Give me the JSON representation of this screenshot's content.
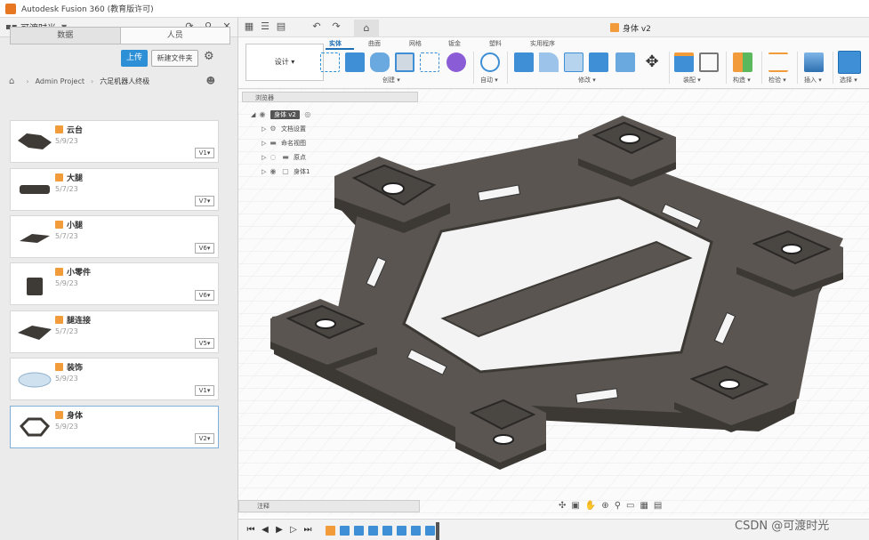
{
  "window": {
    "title": "Autodesk Fusion 360 (教育版许可)"
  },
  "data_panel": {
    "team_name": "可渡时光",
    "tabs": [
      "数据",
      "人员"
    ],
    "upload_label": "上传",
    "new_folder_label": "新建文件夹",
    "breadcrumb": [
      "Admin Project",
      "六足机器人终极"
    ],
    "files": [
      {
        "name": "云台",
        "date": "5/9/23",
        "version": "V1"
      },
      {
        "name": "大腿",
        "date": "5/7/23",
        "version": "V7"
      },
      {
        "name": "小腿",
        "date": "5/7/23",
        "version": "V6"
      },
      {
        "name": "小零件",
        "date": "5/9/23",
        "version": "V6"
      },
      {
        "name": "腿连接",
        "date": "5/7/23",
        "version": "V5"
      },
      {
        "name": "装饰",
        "date": "5/9/23",
        "version": "V1"
      },
      {
        "name": "身体",
        "date": "5/9/23",
        "version": "V2"
      }
    ]
  },
  "document": {
    "title": "身体 v2"
  },
  "ribbon": {
    "workspace": "设计 ▾",
    "tabs": [
      "实体",
      "曲面",
      "网格",
      "钣金",
      "塑料",
      "实用程序"
    ],
    "groups": [
      "创建 ▾",
      "自动 ▾",
      "修改 ▾",
      "装配 ▾",
      "构造 ▾",
      "检验 ▾",
      "插入 ▾",
      "选择 ▾"
    ]
  },
  "browser": {
    "title": "浏览器",
    "root": "身体 v2",
    "items": [
      "文档设置",
      "命名视图",
      "原点",
      "身体1"
    ]
  },
  "comments_label": "注释",
  "watermark": "CSDN @可渡时光",
  "colors": {
    "accent": "#2d8fd5",
    "part": "#4a4641",
    "part_light": "#625d57"
  }
}
